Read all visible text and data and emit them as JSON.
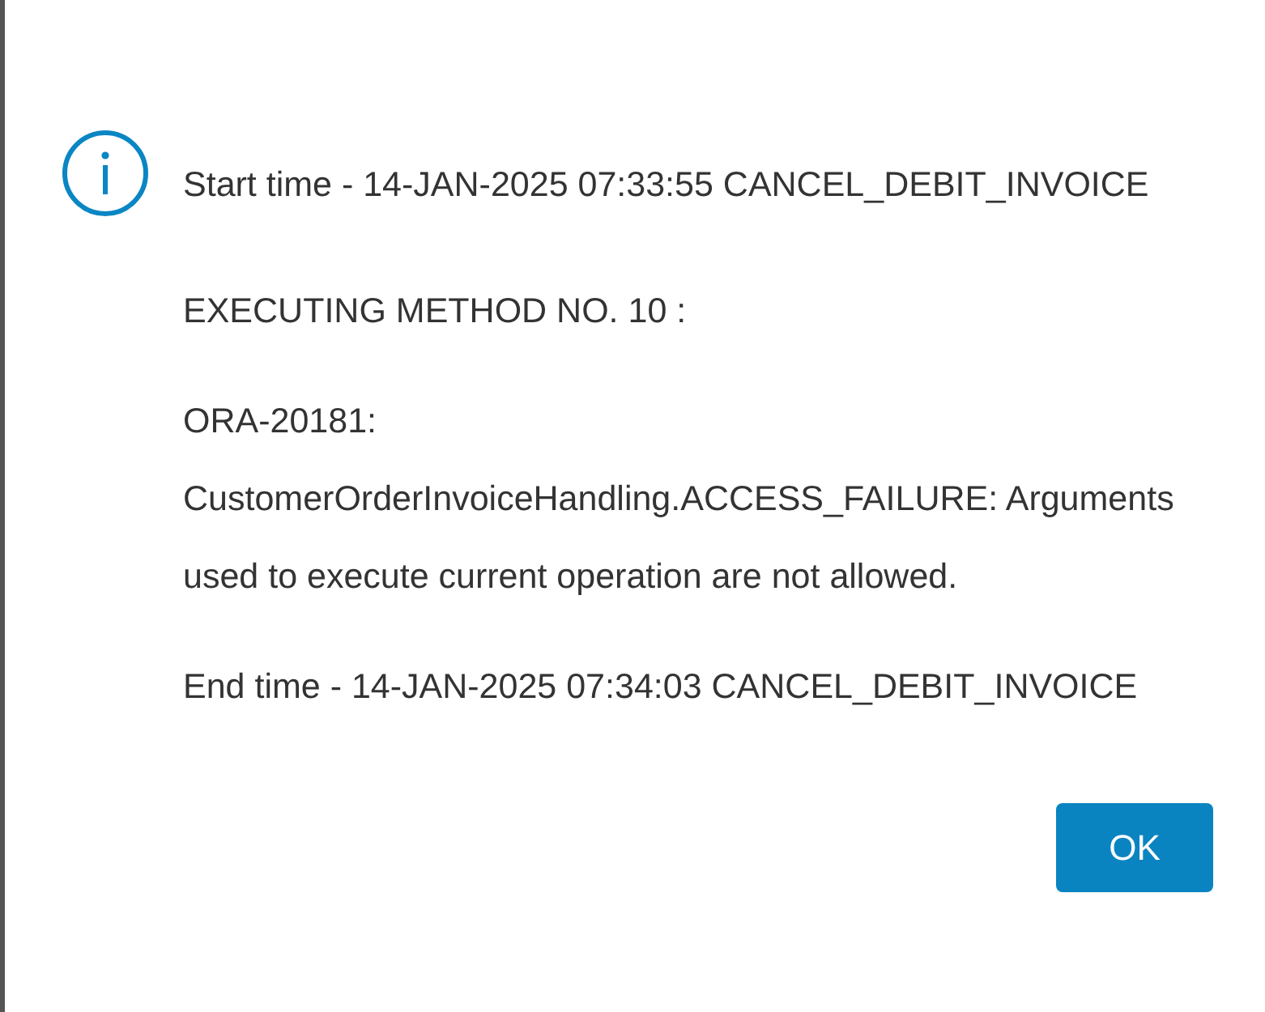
{
  "dialog": {
    "messages": [
      "Start time - 14-JAN-2025 07:33:55 CANCEL_DEBIT_INVOICE",
      "EXECUTING METHOD NO. 10 :",
      "ORA-20181: CustomerOrderInvoiceHandling.ACCESS_FAILURE: Arguments used to execute current operation are not allowed.",
      "End time - 14-JAN-2025 07:34:03 CANCEL_DEBIT_INVOICE"
    ],
    "buttons": [
      "OK"
    ]
  }
}
